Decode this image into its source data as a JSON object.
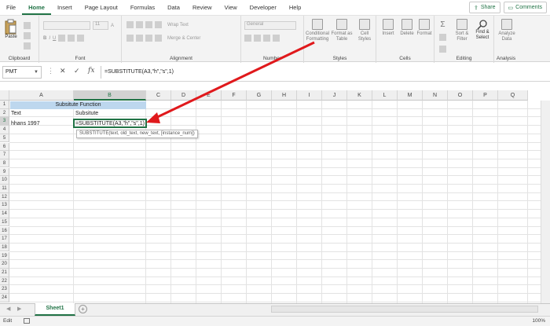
{
  "ribbon_tabs": [
    "File",
    "Home",
    "Insert",
    "Page Layout",
    "Formulas",
    "Data",
    "Review",
    "View",
    "Developer",
    "Help"
  ],
  "active_tab": "Home",
  "share_label": "Share",
  "comments_label": "Comments",
  "groups": {
    "clipboard": "Clipboard",
    "font": "Font",
    "alignment": "Alignment",
    "number": "Number",
    "styles": "Styles",
    "cells": "Cells",
    "editing": "Editing",
    "analysis": "Analysis"
  },
  "buttons": {
    "paste": "Paste",
    "wrap_text": "Wrap Text",
    "merge_center": "Merge & Center",
    "number_format": "General",
    "font_size": "11",
    "conditional": "Conditional\nFormatting",
    "format_table": "Format as\nTable",
    "cell_styles": "Cell\nStyles",
    "insert": "Insert",
    "delete": "Delete",
    "format": "Format",
    "sort_filter": "Sort &\nFilter",
    "find_select": "Find &\nSelect",
    "analyze_data": "Analyze\nData"
  },
  "name_box": "PMT",
  "formula_bar": "=SUBSTITUTE(A3,\"h\",\"s\",1)",
  "columns": [
    "A",
    "B",
    "C",
    "D",
    "E",
    "F",
    "G",
    "H",
    "I",
    "J",
    "K",
    "L",
    "M",
    "N",
    "O",
    "P",
    "Q"
  ],
  "rows": [
    "1",
    "2",
    "3",
    "4",
    "5",
    "6",
    "7",
    "8",
    "9",
    "10",
    "11",
    "12",
    "13",
    "14",
    "15",
    "16",
    "17",
    "18",
    "19",
    "20",
    "21",
    "22",
    "23",
    "24"
  ],
  "cells": {
    "A1": "Subsitute Function",
    "A2": "Text",
    "B2": "Subsitute",
    "A3": "hhans  1997",
    "B3": "=SUBSTITUTE(A3,\"h\",\"s\",1)"
  },
  "tooltip": "SUBSTITUTE(text, old_text, new_text, [instance_num])",
  "sheet_tab": "Sheet1",
  "status": "Edit",
  "zoom": "100%",
  "colors": {
    "accent": "#217346",
    "header_fill": "#bdd7ee",
    "arrow": "#e0191c"
  }
}
